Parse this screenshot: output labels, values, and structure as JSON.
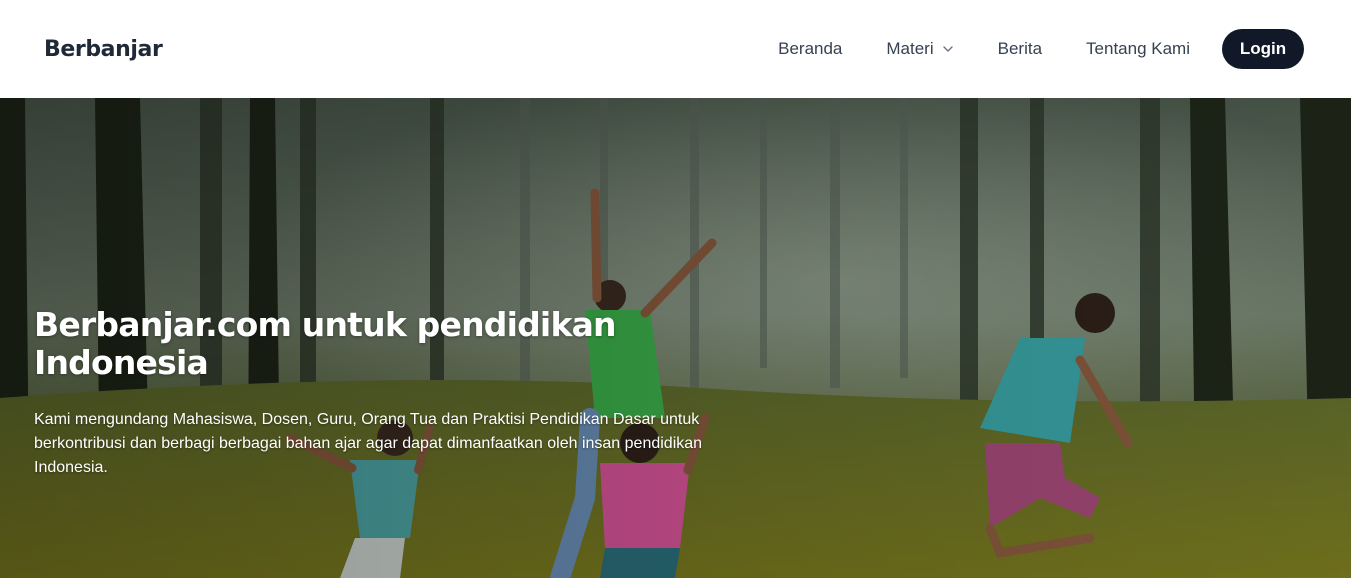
{
  "navbar": {
    "brand": "Berbanjar",
    "links": [
      {
        "label": "Beranda"
      },
      {
        "label": "Materi",
        "has_dropdown": true
      },
      {
        "label": "Berita"
      },
      {
        "label": "Tentang Kami"
      }
    ],
    "login_label": "Login"
  },
  "hero": {
    "title": "Berbanjar.com untuk pendidikan Indonesia",
    "description": "Kami mengundang Mahasiswa, Dosen, Guru, Orang Tua dan Praktisi Pendidikan Dasar untuk berkontribusi dan berbagi berbagai bahan ajar agar dapat dimanfaatkan oleh insan pendidikan Indonesia.",
    "image_subject": "children jumping in a misty forest clearing"
  },
  "colors": {
    "brand_text": "#1f2937",
    "nav_text": "#374151",
    "login_bg": "#111827",
    "login_text": "#ffffff"
  },
  "icons": {
    "materi_dropdown": "chevron-down-icon"
  }
}
